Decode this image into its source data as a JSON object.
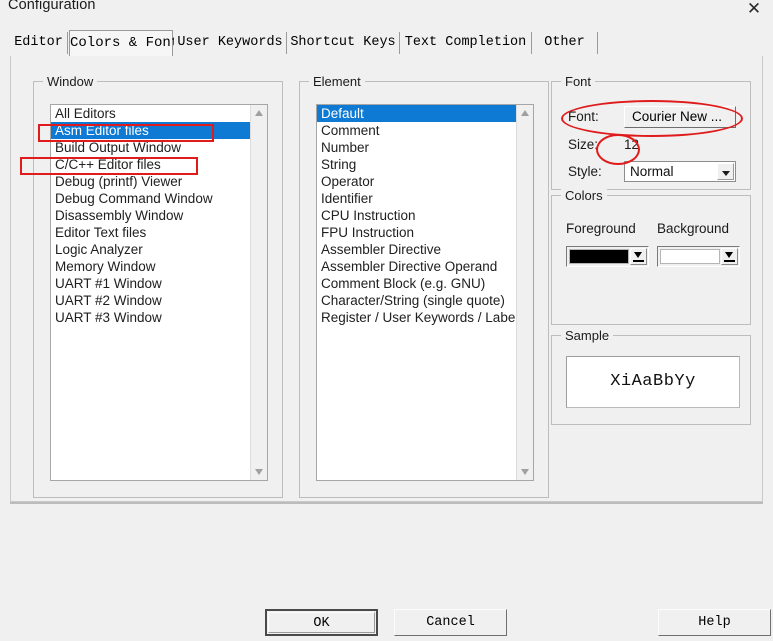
{
  "window": {
    "title": "Configuration",
    "close_icon": "close-icon"
  },
  "tabs": [
    {
      "label": "Editor",
      "active": false
    },
    {
      "label": "Colors & Fonts",
      "active": true
    },
    {
      "label": "User Keywords",
      "active": false
    },
    {
      "label": "Shortcut Keys",
      "active": false
    },
    {
      "label": "Text Completion",
      "active": false
    },
    {
      "label": "Other",
      "active": false
    }
  ],
  "window_group": {
    "title": "Window",
    "items": [
      {
        "label": "All Editors",
        "selected": false
      },
      {
        "label": "Asm Editor files",
        "selected": true
      },
      {
        "label": "Build Output Window",
        "selected": false
      },
      {
        "label": "C/C++ Editor files",
        "selected": false
      },
      {
        "label": "Debug (printf) Viewer",
        "selected": false
      },
      {
        "label": "Debug Command Window",
        "selected": false
      },
      {
        "label": "Disassembly Window",
        "selected": false
      },
      {
        "label": "Editor Text files",
        "selected": false
      },
      {
        "label": "Logic Analyzer",
        "selected": false
      },
      {
        "label": "Memory Window",
        "selected": false
      },
      {
        "label": "UART #1 Window",
        "selected": false
      },
      {
        "label": "UART #2 Window",
        "selected": false
      },
      {
        "label": "UART #3 Window",
        "selected": false
      }
    ]
  },
  "element_group": {
    "title": "Element",
    "items": [
      {
        "label": "Default",
        "selected": true
      },
      {
        "label": "Comment",
        "selected": false
      },
      {
        "label": "Number",
        "selected": false
      },
      {
        "label": "String",
        "selected": false
      },
      {
        "label": "Operator",
        "selected": false
      },
      {
        "label": "Identifier",
        "selected": false
      },
      {
        "label": "CPU Instruction",
        "selected": false
      },
      {
        "label": "FPU Instruction",
        "selected": false
      },
      {
        "label": "Assembler Directive",
        "selected": false
      },
      {
        "label": "Assembler Directive Operand",
        "selected": false
      },
      {
        "label": "Comment Block (e.g. GNU)",
        "selected": false
      },
      {
        "label": "Character/String (single quote)",
        "selected": false
      },
      {
        "label": "Register / User Keywords / Label",
        "selected": false
      }
    ]
  },
  "font_group": {
    "title": "Font",
    "font_label": "Font:",
    "font_value": "Courier New ...",
    "size_label": "Size:",
    "size_value": "12",
    "style_label": "Style:",
    "style_value": "Normal"
  },
  "colors_group": {
    "title": "Colors",
    "foreground_label": "Foreground",
    "background_label": "Background",
    "foreground_color": "#000000",
    "background_color": "#ffffff"
  },
  "sample_group": {
    "title": "Sample",
    "text": "XiAaBbYy"
  },
  "buttons": {
    "ok": "OK",
    "cancel": "Cancel",
    "help": "Help"
  },
  "annotations": {
    "color": "#e01b1b",
    "notes": [
      "rect-around-asm-editor-files",
      "rect-around-c-cpp-editor-files",
      "ellipse-around-font-value",
      "ellipse-around-size-value"
    ]
  }
}
